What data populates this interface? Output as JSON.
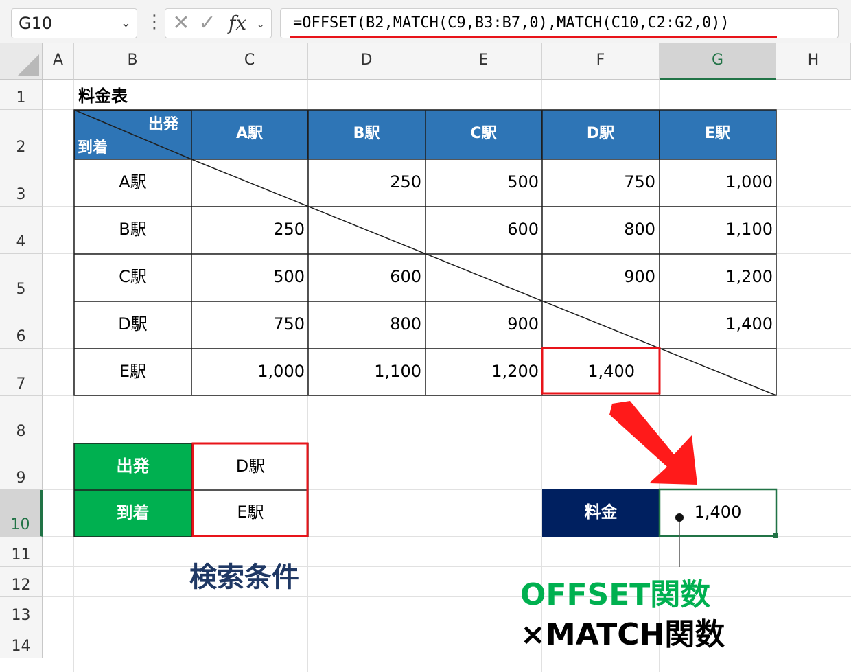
{
  "formula_bar": {
    "name_box": "G10",
    "formula": "=OFFSET(B2,MATCH(C9,B3:B7,0),MATCH(C10,C2:G2,0))",
    "cancel_glyph": "✕",
    "enter_glyph": "✓",
    "fx_label": "fx"
  },
  "columns": [
    "A",
    "B",
    "C",
    "D",
    "E",
    "F",
    "G",
    "H"
  ],
  "rows": [
    "1",
    "2",
    "3",
    "4",
    "5",
    "6",
    "7",
    "8",
    "9",
    "10",
    "11",
    "12",
    "13",
    "14"
  ],
  "selected_column": "G",
  "selected_row": "10",
  "sheet": {
    "title": "料金表",
    "corner_departure": "出発",
    "corner_arrival": "到着",
    "station_headers": [
      "A駅",
      "B駅",
      "C駅",
      "D駅",
      "E駅"
    ],
    "row_labels": [
      "A駅",
      "B駅",
      "C駅",
      "D駅",
      "E駅"
    ],
    "fares": [
      [
        "",
        "250",
        "500",
        "750",
        "1,000"
      ],
      [
        "250",
        "",
        "600",
        "800",
        "1,100"
      ],
      [
        "500",
        "600",
        "",
        "900",
        "1,200"
      ],
      [
        "750",
        "800",
        "900",
        "",
        "1,400"
      ],
      [
        "1,000",
        "1,100",
        "1,200",
        "1,400",
        ""
      ]
    ],
    "lookup": {
      "departure_label": "出発",
      "departure_value": "D駅",
      "arrival_label": "到着",
      "arrival_value": "E駅"
    },
    "result": {
      "label": "料金",
      "value": "1,400"
    }
  },
  "annotations": {
    "conditions_label": "検索条件",
    "function_line1": "OFFSET関数",
    "function_line2": "×MATCH関数"
  },
  "colors": {
    "header_blue": "#2e75b6",
    "lookup_green": "#00b050",
    "result_navy": "#002060",
    "highlight_red": "#e8141a",
    "excel_green": "#217346"
  }
}
